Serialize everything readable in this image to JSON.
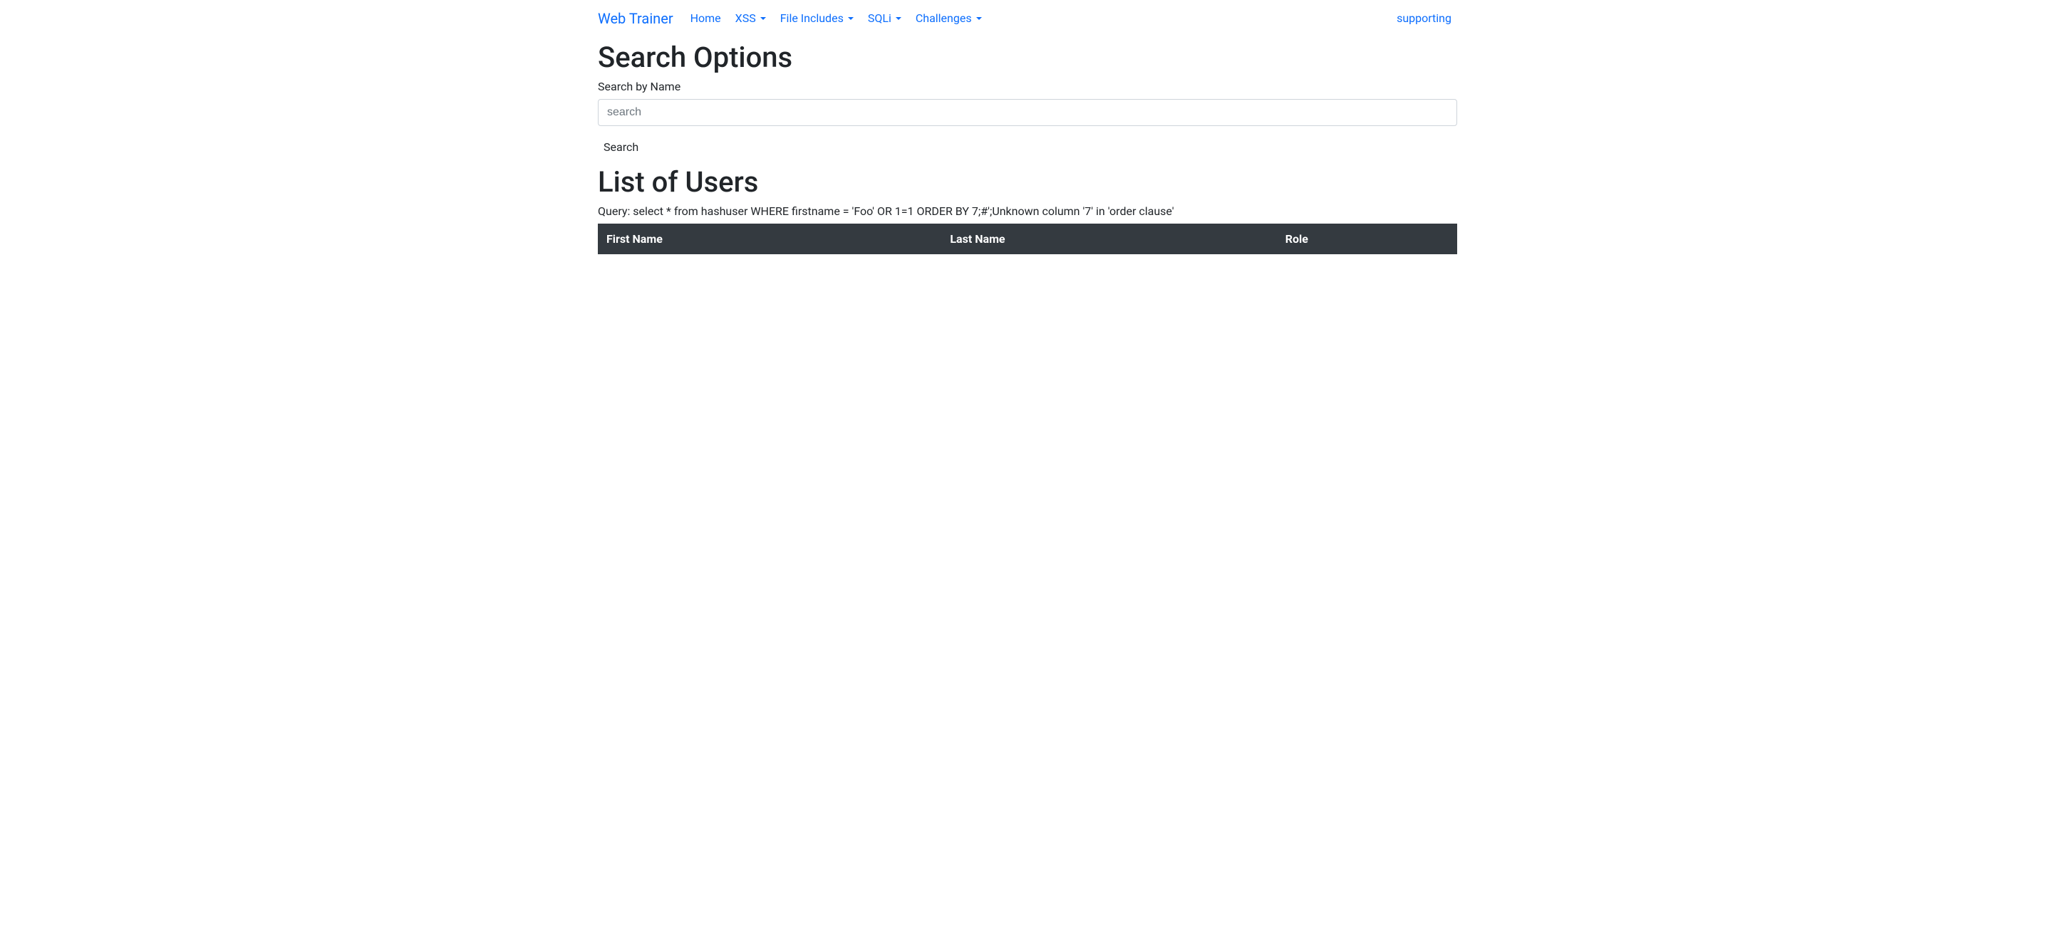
{
  "navbar": {
    "brand": "Web Trainer",
    "items": [
      {
        "label": "Home",
        "dropdown": false
      },
      {
        "label": "XSS",
        "dropdown": true
      },
      {
        "label": "File Includes",
        "dropdown": true
      },
      {
        "label": "SQLi",
        "dropdown": true
      },
      {
        "label": "Challenges",
        "dropdown": true
      }
    ],
    "right": "supporting"
  },
  "search": {
    "heading": "Search Options",
    "label": "Search by Name",
    "placeholder": "search",
    "button": "Search"
  },
  "results": {
    "heading": "List of Users",
    "query": "Query: select * from hashuser WHERE firstname = 'Foo' OR 1=1 ORDER BY 7;#';Unknown column '7' in 'order clause'",
    "columns": [
      "First Name",
      "Last Name",
      "Role"
    ],
    "rows": []
  }
}
